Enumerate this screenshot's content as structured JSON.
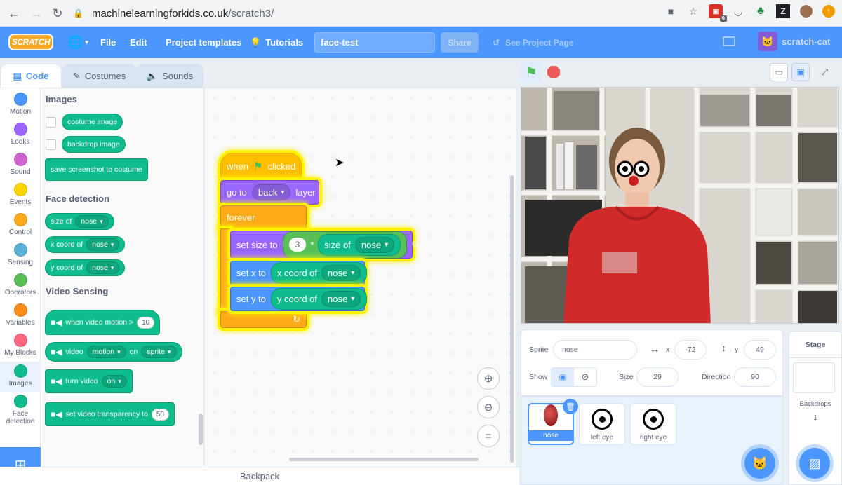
{
  "browser": {
    "url_host": "machinelearningforkids.co.uk",
    "url_path": "/scratch3/",
    "ext_badge": "9",
    "ext_z": "Z"
  },
  "menu": {
    "logo": "SCRATCH",
    "file": "File",
    "edit": "Edit",
    "project_templates": "Project templates",
    "tutorials": "Tutorials",
    "project_title": "face-test",
    "share": "Share",
    "see_project_page": "See Project Page",
    "username": "scratch-cat"
  },
  "tabs": {
    "code": "Code",
    "costumes": "Costumes",
    "sounds": "Sounds"
  },
  "categories": [
    {
      "label": "Motion",
      "color": "#4c97ff"
    },
    {
      "label": "Looks",
      "color": "#9966ff"
    },
    {
      "label": "Sound",
      "color": "#cf63cf"
    },
    {
      "label": "Events",
      "color": "#ffd500"
    },
    {
      "label": "Control",
      "color": "#ffab19"
    },
    {
      "label": "Sensing",
      "color": "#5cb1d6"
    },
    {
      "label": "Operators",
      "color": "#59c059"
    },
    {
      "label": "Variables",
      "color": "#ff8c1a"
    },
    {
      "label": "My Blocks",
      "color": "#ff6680"
    },
    {
      "label": "Images",
      "color": "#0fbd8c"
    },
    {
      "label": "Face detection",
      "color": "#0fbd8c"
    }
  ],
  "palette": {
    "images_heading": "Images",
    "costume_image": "costume image",
    "backdrop_image": "backdrop image",
    "save_screenshot": "save screenshot to costume",
    "face_heading": "Face detection",
    "size_of": "size of",
    "x_coord_of": "x coord of",
    "y_coord_of": "y coord of",
    "nose": "nose",
    "video_heading": "Video Sensing",
    "when_video_motion": "when video motion >",
    "motion_threshold": "10",
    "video": "video",
    "motion": "motion",
    "on": "on",
    "sprite": "sprite",
    "turn_video": "turn video",
    "turn_on": "on",
    "set_transparency": "set video transparency to",
    "transparency_value": "50"
  },
  "script": {
    "when": "when",
    "clicked": "clicked",
    "go_to": "go to",
    "back": "back",
    "layer": "layer",
    "forever": "forever",
    "set_size_to": "set size to",
    "multiplier": "3",
    "times": "*",
    "size_of": "size of",
    "nose": "nose",
    "percent": "%",
    "set_x_to": "set x to",
    "x_coord_of": "x coord of",
    "set_y_to": "set y to",
    "y_coord_of": "y coord of",
    "loop_arrow": "↻"
  },
  "backpack": "Backpack",
  "sprite_info": {
    "sprite_label": "Sprite",
    "sprite_name": "nose",
    "x_label": "x",
    "x_value": "-72",
    "y_label": "y",
    "y_value": "49",
    "show_label": "Show",
    "size_label": "Size",
    "size_value": "29",
    "direction_label": "Direction",
    "direction_value": "90"
  },
  "sprites": [
    {
      "name": "nose"
    },
    {
      "name": "left eye"
    },
    {
      "name": "right eye"
    }
  ],
  "stage_pane": {
    "title": "Stage",
    "backdrops_label": "Backdrops",
    "backdrops_count": "1"
  }
}
